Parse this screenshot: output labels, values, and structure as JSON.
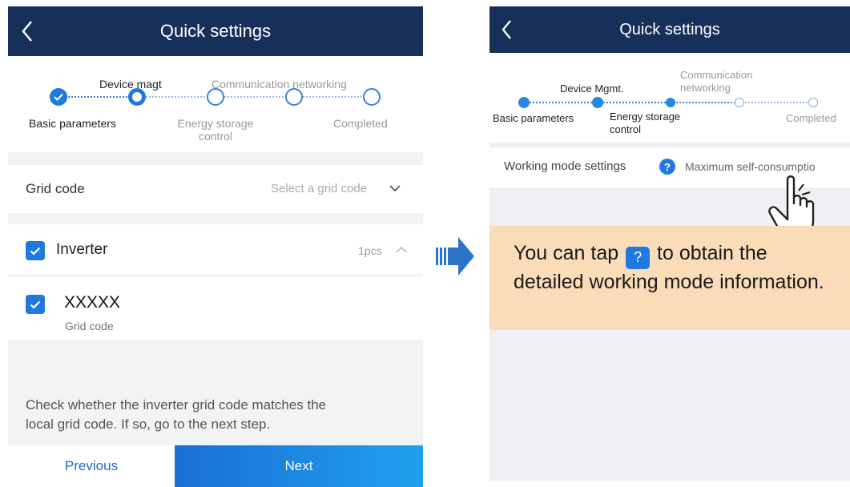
{
  "left_screen": {
    "header": {
      "title": "Quick settings",
      "back_icon": "chevron-left-icon"
    },
    "stepper": {
      "steps": [
        {
          "label": "Basic parameters",
          "state": "done"
        },
        {
          "label": "Device magt",
          "state": "current"
        },
        {
          "label": "Energy storage control",
          "label_line1": "Energy storage",
          "label_line2": "control",
          "state": "pending"
        },
        {
          "label": "Communication networking",
          "state": "pending"
        },
        {
          "label": "Completed",
          "state": "pending"
        }
      ]
    },
    "grid_code_row": {
      "label": "Grid code",
      "placeholder": "Select a grid code",
      "icon": "chevron-down-icon"
    },
    "device_group": {
      "name": "Inverter",
      "count": "1pcs",
      "checked": true,
      "icon": "chevron-up-icon"
    },
    "device_item": {
      "name": "XXXXX",
      "sub_label": "Grid code",
      "checked": true
    },
    "hint": {
      "text": "Check whether the inverter grid code matches the local grid code. If so, go to the next step.",
      "line1": "Check whether the inverter grid code matches the",
      "line2": "local grid code. If so, go to the next step."
    },
    "footer": {
      "previous_label": "Previous",
      "next_label": "Next"
    }
  },
  "transition_icon": "arrow-right-icon",
  "right_screen": {
    "header": {
      "title": "Quick settings",
      "back_icon": "chevron-left-icon"
    },
    "stepper": {
      "steps": [
        {
          "label": "Basic parameters",
          "state": "done"
        },
        {
          "label": "Device Mgmt.",
          "state": "done"
        },
        {
          "label": "Energy storage control",
          "label_line1": "Energy storage",
          "label_line2": "control",
          "state": "current"
        },
        {
          "label": "Communication networking",
          "label_line1": "Communication",
          "label_line2": "networking",
          "state": "pending"
        },
        {
          "label": "Completed",
          "state": "pending"
        }
      ]
    },
    "working_mode_row": {
      "label": "Working mode settings",
      "help_icon": "question-icon",
      "value": "Maximum self-consumptio"
    },
    "pointer_icon": "hand-pointer-icon",
    "callout": {
      "text_before": "You can tap",
      "badge": "?",
      "text_after": "to obtain the detailed working mode information."
    }
  },
  "colors": {
    "header_bg": "#16305a",
    "accent": "#1f7ae0",
    "callout_bg": "#fadcb8"
  }
}
